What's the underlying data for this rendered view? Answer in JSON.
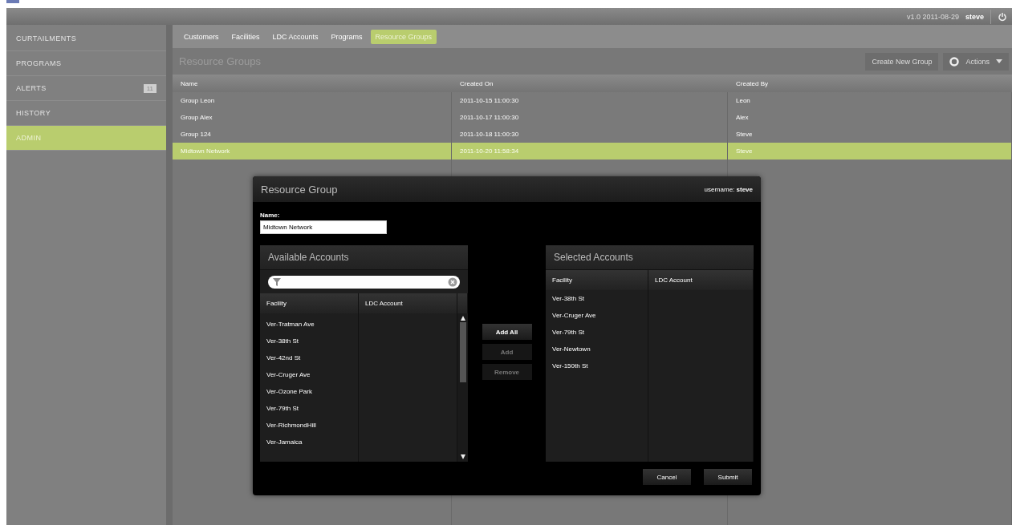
{
  "top_bar": {
    "version": "v1.0 2011-08-29",
    "user": "steve"
  },
  "sidebar": {
    "items": [
      {
        "label": "CURTAILMENTS",
        "selected": false
      },
      {
        "label": "PROGRAMS",
        "selected": false
      },
      {
        "label": "ALERTS",
        "selected": false,
        "badge": "11"
      },
      {
        "label": "HISTORY",
        "selected": false
      },
      {
        "label": "ADMIN",
        "selected": true
      }
    ]
  },
  "tabs": [
    {
      "label": "Customers",
      "selected": false
    },
    {
      "label": "Facilities",
      "selected": false
    },
    {
      "label": "LDC Accounts",
      "selected": false
    },
    {
      "label": "Programs",
      "selected": false
    },
    {
      "label": "Resource Groups",
      "selected": true
    }
  ],
  "page_title": "Resource Groups",
  "toolbar": {
    "create_button": "Create New Group",
    "actions_button": "Actions"
  },
  "table": {
    "columns": [
      "Name",
      "Created On",
      "Created By"
    ],
    "rows": [
      {
        "cells": [
          "Group Leon",
          "2011-10-15 11:00:30",
          "Leon"
        ],
        "selected": false
      },
      {
        "cells": [
          "Group Alex",
          "2011-10-17 11:00:30",
          "Alex"
        ],
        "selected": false
      },
      {
        "cells": [
          "Group 124",
          "2011-10-18 11:00:30",
          "Steve"
        ],
        "selected": false
      },
      {
        "cells": [
          "Midtown Network",
          "2011-10-20 11:58:34",
          "Steve"
        ],
        "selected": true
      }
    ]
  },
  "dialog": {
    "title": "Resource Group",
    "username_label": "username:",
    "username": "steve",
    "name_label": "Name:",
    "name_value": "Midtown Network",
    "available": {
      "title": "Available Accounts",
      "columns": [
        "Facility",
        "LDC Account"
      ],
      "rows": [
        "Ver-Tratman Ave",
        "Ver-38th St",
        "Ver-42nd St",
        "Ver-Cruger Ave",
        "Ver-Ozone Park",
        "Ver-79th St",
        "Ver-RichmondHill",
        "Ver-Jamaica"
      ]
    },
    "transfer_buttons": [
      {
        "label": "Add All",
        "disabled": false
      },
      {
        "label": "Add",
        "disabled": true
      },
      {
        "label": "Remove",
        "disabled": true
      }
    ],
    "selected": {
      "title": "Selected Accounts",
      "columns": [
        "Facility",
        "LDC Account"
      ],
      "rows": [
        "Ver-38th St",
        "Ver-Cruger Ave",
        "Ver-79th St",
        "Ver-Newtown",
        "Ver-150th St"
      ]
    },
    "footer_buttons": [
      "Cancel",
      "Submit"
    ]
  }
}
